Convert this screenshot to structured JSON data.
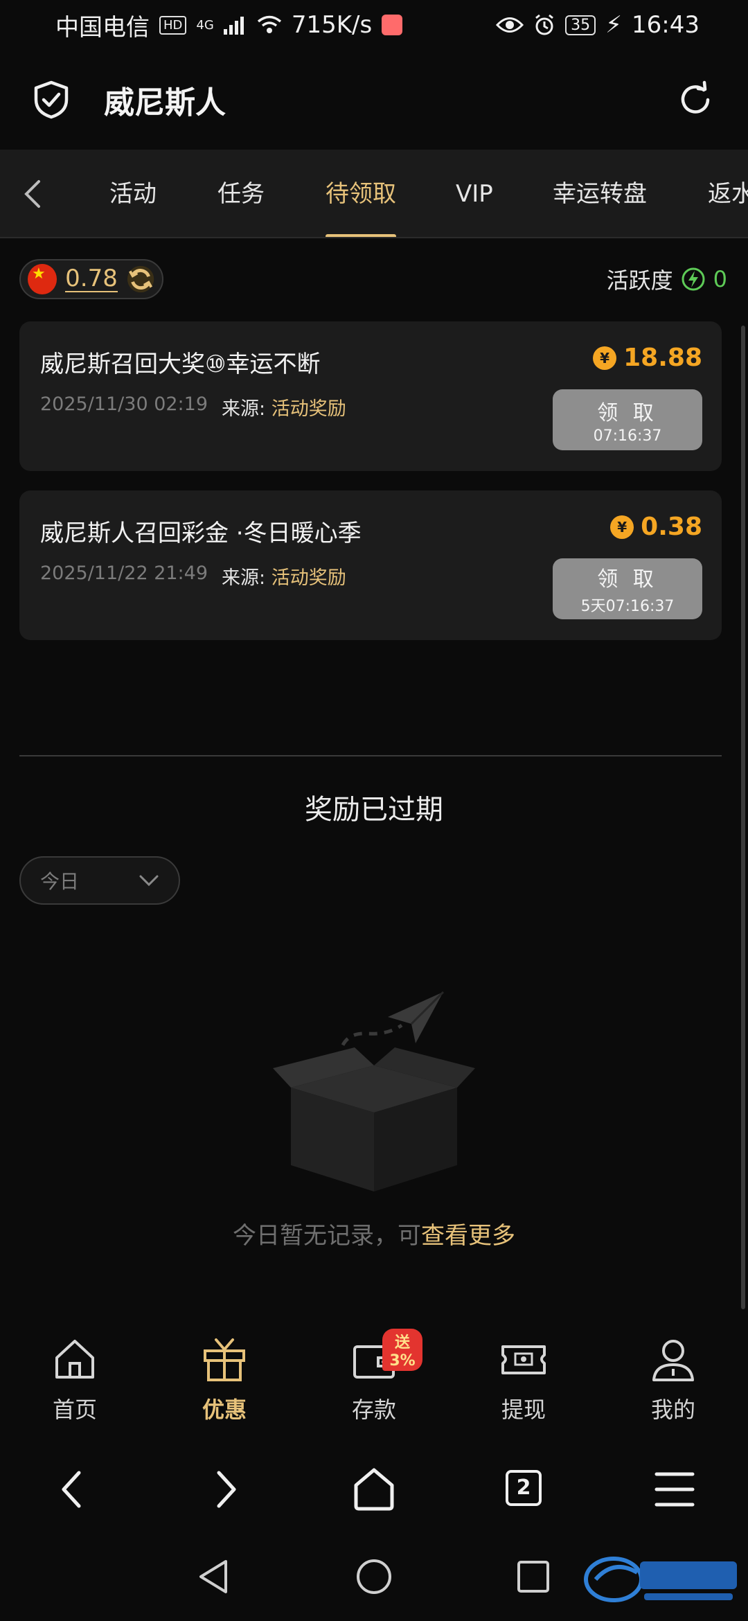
{
  "status_bar": {
    "carrier": "中国电信",
    "network_chip": "HD",
    "signal": "4G",
    "speed": "715K/s",
    "battery": "35",
    "time": "16:43"
  },
  "header": {
    "title": "威尼斯人"
  },
  "tabs": [
    {
      "label": "活动"
    },
    {
      "label": "任务"
    },
    {
      "label": "待领取"
    },
    {
      "label": "VIP"
    },
    {
      "label": "幸运转盘"
    },
    {
      "label": "返水"
    }
  ],
  "active_tab": "待领取",
  "balance": {
    "amount": "0.78"
  },
  "activity": {
    "label": "活跃度",
    "value": "0"
  },
  "rewards": [
    {
      "title": "威尼斯召回大奖⑩幸运不断",
      "date": "2025/11/30 02:19",
      "source_label": "来源:",
      "source_value": "活动奖励",
      "amount": "18.88",
      "claim_label": "领 取",
      "countdown": "07:16:37"
    },
    {
      "title": "威尼斯人召回彩金 ·冬日暖心季",
      "date": "2025/11/22 21:49",
      "source_label": "来源:",
      "source_value": "活动奖励",
      "amount": "0.38",
      "claim_label": "领 取",
      "countdown": "5天07:16:37"
    }
  ],
  "expired": {
    "title": "奖励已过期",
    "filter_value": "今日",
    "empty_text": "今日暂无记录，可",
    "more_link": "查看更多"
  },
  "bottom_nav": [
    {
      "label": "首页",
      "icon": "home-icon"
    },
    {
      "label": "优惠",
      "icon": "gift-icon"
    },
    {
      "label": "存款",
      "icon": "wallet-icon",
      "badge": "送3%"
    },
    {
      "label": "提现",
      "icon": "cash-icon"
    },
    {
      "label": "我的",
      "icon": "user-icon"
    }
  ],
  "browser": {
    "tab_count": "2"
  },
  "colors": {
    "accent": "#e7c27a",
    "reward": "#f5a623",
    "activity": "#5ecb57",
    "badge": "#e3342f"
  }
}
